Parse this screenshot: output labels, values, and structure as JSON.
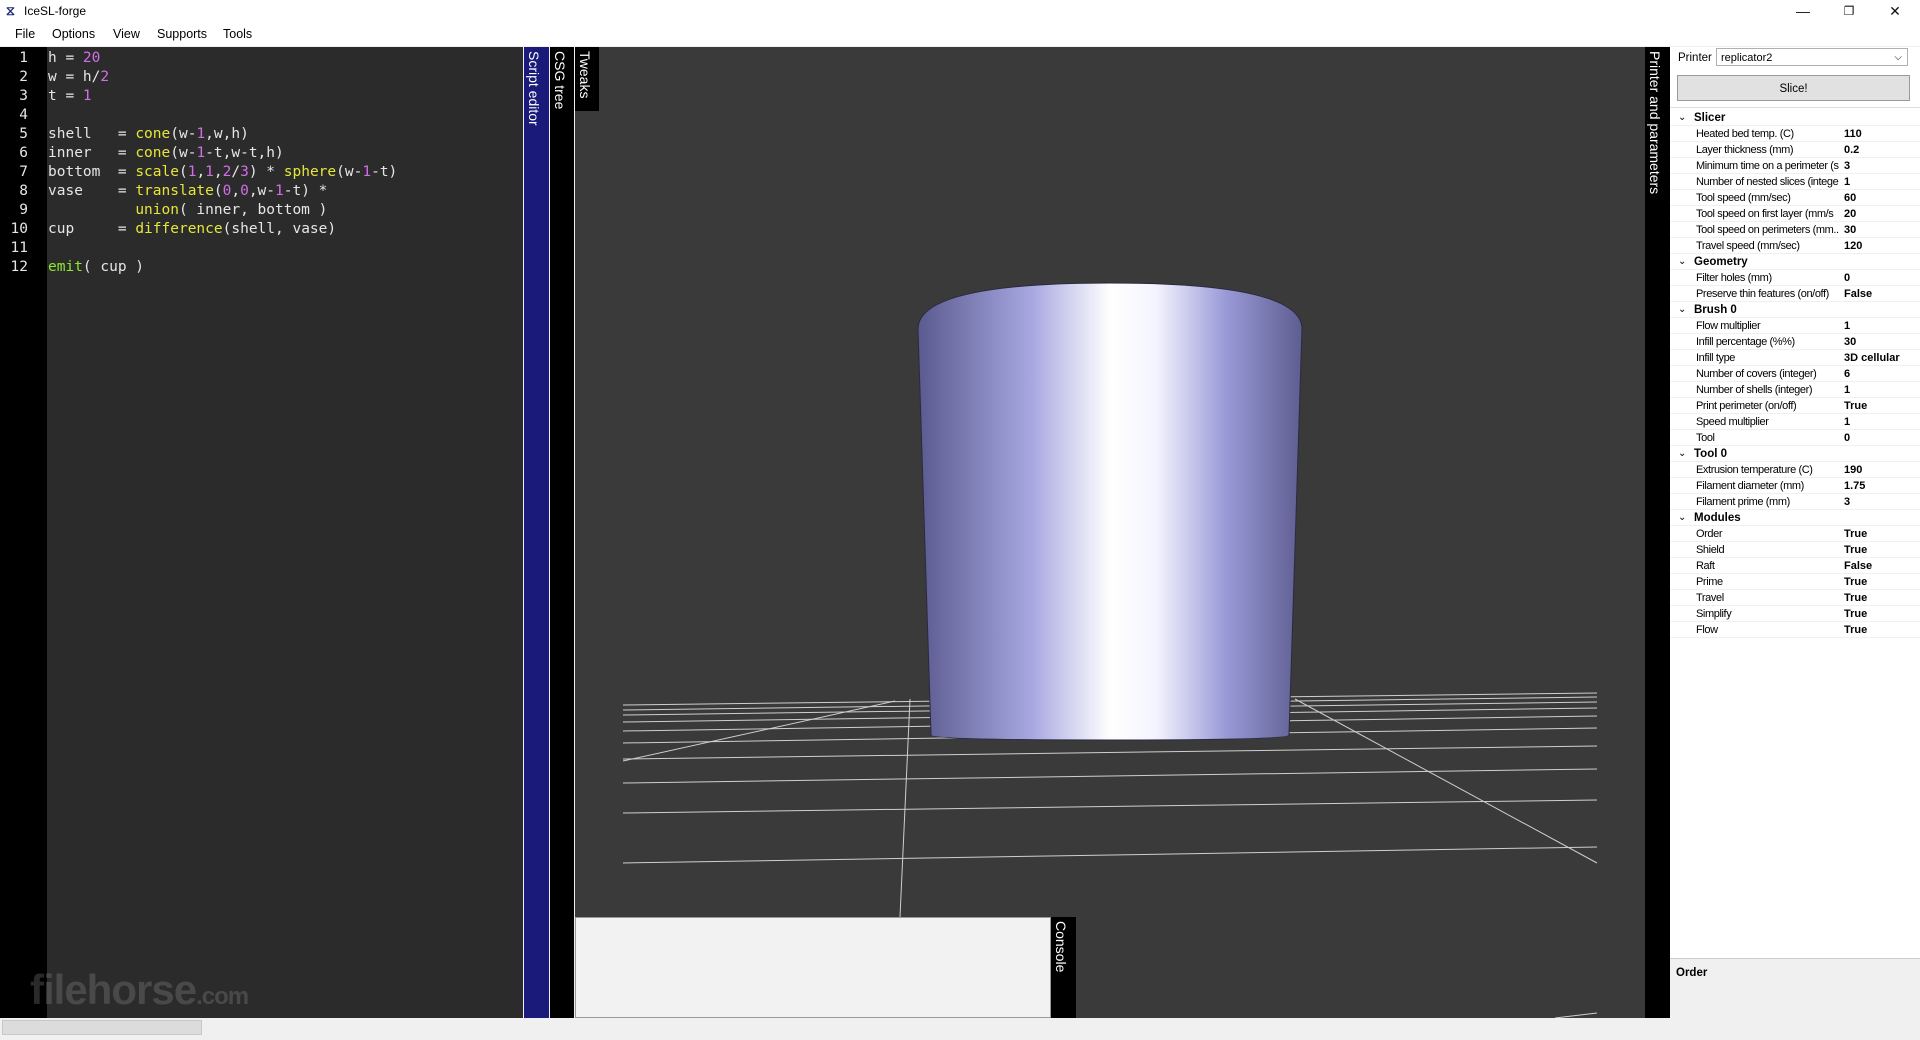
{
  "window": {
    "title": "IceSL-forge",
    "controls": {
      "minimize": "—",
      "maximize": "❐",
      "close": "✕"
    }
  },
  "menu": [
    "File",
    "Options",
    "View",
    "Supports",
    "Tools"
  ],
  "editor": {
    "lines": [
      [
        {
          "t": "h = "
        },
        {
          "t": "20",
          "c": "num"
        }
      ],
      [
        {
          "t": "w = h/"
        },
        {
          "t": "2",
          "c": "num"
        }
      ],
      [
        {
          "t": "t = "
        },
        {
          "t": "1",
          "c": "num"
        }
      ],
      [],
      [
        {
          "t": "shell   = "
        },
        {
          "t": "cone",
          "c": "fn"
        },
        {
          "t": "(w-"
        },
        {
          "t": "1",
          "c": "num"
        },
        {
          "t": ",w,h)"
        }
      ],
      [
        {
          "t": "inner   = "
        },
        {
          "t": "cone",
          "c": "fn"
        },
        {
          "t": "(w-"
        },
        {
          "t": "1",
          "c": "num"
        },
        {
          "t": "-t,w-t,h)"
        }
      ],
      [
        {
          "t": "bottom  = "
        },
        {
          "t": "scale",
          "c": "fn"
        },
        {
          "t": "("
        },
        {
          "t": "1",
          "c": "num"
        },
        {
          "t": ","
        },
        {
          "t": "1",
          "c": "num"
        },
        {
          "t": ","
        },
        {
          "t": "2",
          "c": "num"
        },
        {
          "t": "/"
        },
        {
          "t": "3",
          "c": "num"
        },
        {
          "t": ") * "
        },
        {
          "t": "sphere",
          "c": "fn"
        },
        {
          "t": "(w-"
        },
        {
          "t": "1",
          "c": "num"
        },
        {
          "t": "-t)"
        }
      ],
      [
        {
          "t": "vase    = "
        },
        {
          "t": "translate",
          "c": "fn"
        },
        {
          "t": "("
        },
        {
          "t": "0",
          "c": "num"
        },
        {
          "t": ","
        },
        {
          "t": "0",
          "c": "num"
        },
        {
          "t": ",w-"
        },
        {
          "t": "1",
          "c": "num"
        },
        {
          "t": "-t) *"
        }
      ],
      [
        {
          "t": "          "
        },
        {
          "t": "union",
          "c": "fn"
        },
        {
          "t": "( inner, bottom )"
        }
      ],
      [
        {
          "t": "cup     = "
        },
        {
          "t": "difference",
          "c": "fn"
        },
        {
          "t": "(shell, vase)"
        }
      ],
      [],
      [
        {
          "t": "emit",
          "c": "kw"
        },
        {
          "t": "( cup )"
        }
      ]
    ],
    "watermark": "filehorse",
    "watermark_suffix": ".com"
  },
  "tabs": {
    "script_editor": "Script editor",
    "csg_tree": "CSG tree",
    "tweaks": "Tweaks",
    "console": "Console",
    "printer_params": "Printer and parameters"
  },
  "right_panel": {
    "printer_label": "Printer",
    "printer_value": "replicator2",
    "slice_label": "Slice!",
    "sections": [
      {
        "name": "Slicer",
        "rows": [
          [
            "Heated bed temp. (C)",
            "110"
          ],
          [
            "Layer thickness (mm)",
            "0.2"
          ],
          [
            "Minimum time on a perimeter (s",
            "3"
          ],
          [
            "Number of nested slices (intege",
            "1"
          ],
          [
            "Tool speed (mm/sec)",
            "60"
          ],
          [
            "Tool speed on first layer (mm/s",
            "20"
          ],
          [
            "Tool speed on perimeters (mm..",
            "30"
          ],
          [
            "Travel speed (mm/sec)",
            "120"
          ]
        ]
      },
      {
        "name": "Geometry",
        "rows": [
          [
            "Filter holes (mm)",
            "0"
          ],
          [
            "Preserve thin features (on/off)",
            "False"
          ]
        ]
      },
      {
        "name": "Brush 0",
        "rows": [
          [
            "Flow multiplier",
            "1"
          ],
          [
            "Infill percentage (%%)",
            "30"
          ],
          [
            "Infill type",
            "3D cellular"
          ],
          [
            "Number of covers (integer)",
            "6"
          ],
          [
            "Number of shells (integer)",
            "1"
          ],
          [
            "Print perimeter (on/off)",
            "True"
          ],
          [
            "Speed multiplier",
            "1"
          ],
          [
            "Tool",
            "0"
          ]
        ]
      },
      {
        "name": "Tool 0",
        "rows": [
          [
            "Extrusion temperature (C)",
            "190"
          ],
          [
            "Filament diameter (mm)",
            "1.75"
          ],
          [
            "Filament prime (mm)",
            "3"
          ]
        ]
      },
      {
        "name": "Modules",
        "rows": [
          [
            "Order",
            "True"
          ],
          [
            "Shield",
            "True"
          ],
          [
            "Raft",
            "False"
          ],
          [
            "Prime",
            "True"
          ],
          [
            "Travel",
            "True"
          ],
          [
            "Simplify",
            "True"
          ],
          [
            "Flow",
            "True"
          ]
        ]
      }
    ],
    "description_title": "Order"
  },
  "colors": {
    "editor_bg": "#2b2b2b",
    "viewport_bg": "#3a3a3a",
    "script_tab_active": "#1a1a7a",
    "number": "#d26ee8",
    "function": "#e6e63a",
    "keyword": "#8ee82c"
  }
}
